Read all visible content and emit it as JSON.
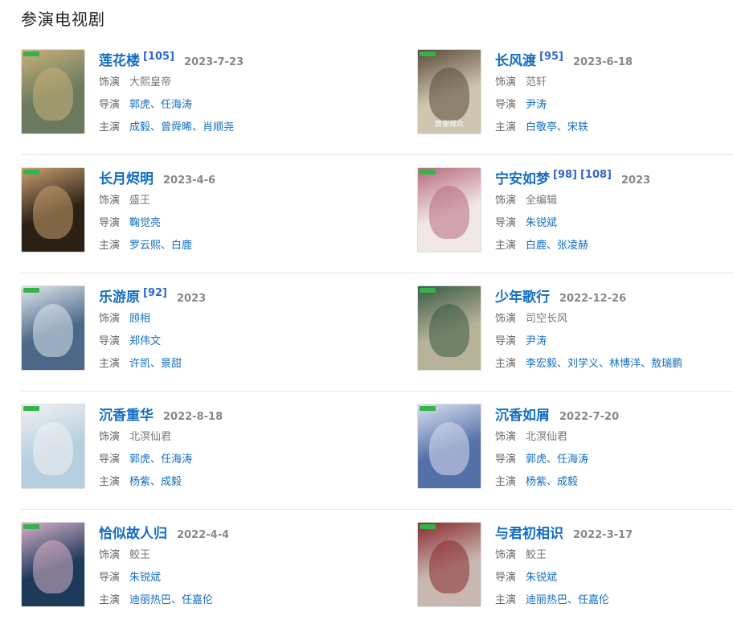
{
  "section_title": "参演电视剧",
  "labels": {
    "role": "饰演",
    "director": "导演",
    "starring": "主演"
  },
  "dramas": [
    {
      "title": "莲花楼",
      "refs": [
        "[105]"
      ],
      "date": "2023-7-23",
      "role": "大熙皇帝",
      "role_linked": false,
      "directors": [
        "郭虎",
        "任海涛"
      ],
      "starring": [
        "成毅",
        "曾舜晞",
        "肖顺尧"
      ],
      "poster_color": "#6b7a5e",
      "poster_accent": "#c8b07a"
    },
    {
      "title": "长风渡",
      "refs": [
        "[95]"
      ],
      "date": "2023-6-18",
      "role": "范轩",
      "role_linked": false,
      "directors": [
        "尹涛"
      ],
      "starring": [
        "白敬亭",
        "宋轶"
      ],
      "poster_color": "#cfc6b0",
      "poster_accent": "#5a4a3a",
      "poster_caption": "致谢观众"
    },
    {
      "title": "长月烬明",
      "refs": [],
      "date": "2023-4-6",
      "role": "盛王",
      "role_linked": false,
      "directors": [
        "鞠觉亮"
      ],
      "starring": [
        "罗云熙",
        "白鹿"
      ],
      "poster_color": "#2a2016",
      "poster_accent": "#c8a070"
    },
    {
      "title": "宁安如梦",
      "refs": [
        "[98]",
        "[108]"
      ],
      "date": "2023",
      "role": "全编辑",
      "role_linked": false,
      "directors": [
        "朱锐斌"
      ],
      "starring": [
        "白鹿",
        "张凌赫"
      ],
      "poster_color": "#efe8e6",
      "poster_accent": "#b86a80"
    },
    {
      "title": "乐游原",
      "refs": [
        "[92]"
      ],
      "date": "2023",
      "role": "顾相",
      "role_linked": true,
      "directors": [
        "郑伟文"
      ],
      "starring": [
        "许凯",
        "景甜"
      ],
      "poster_color": "#4b6888",
      "poster_accent": "#dfe6ee"
    },
    {
      "title": "少年歌行",
      "refs": [],
      "date": "2022-12-26",
      "role": "司空长风",
      "role_linked": false,
      "directors": [
        "尹涛"
      ],
      "starring": [
        "李宏毅",
        "刘学义",
        "林博洋",
        "敖瑞鹏"
      ],
      "poster_color": "#b7b29a",
      "poster_accent": "#3a5a42"
    },
    {
      "title": "沉香重华",
      "refs": [],
      "date": "2022-8-18",
      "role": "北溟仙君",
      "role_linked": false,
      "directors": [
        "郭虎",
        "任海涛"
      ],
      "starring": [
        "杨紫",
        "成毅"
      ],
      "poster_color": "#b6cfe0",
      "poster_accent": "#f2f2f2"
    },
    {
      "title": "沉香如屑",
      "refs": [],
      "date": "2022-7-20",
      "role": "北溟仙君",
      "role_linked": false,
      "directors": [
        "郭虎",
        "任海涛"
      ],
      "starring": [
        "杨紫",
        "成毅"
      ],
      "poster_color": "#5470a8",
      "poster_accent": "#d8dff0"
    },
    {
      "title": "恰似故人归",
      "refs": [],
      "date": "2022-4-4",
      "role": "鲛王",
      "role_linked": false,
      "directors": [
        "朱锐斌"
      ],
      "starring": [
        "迪丽热巴",
        "任嘉伦"
      ],
      "poster_color": "#1e3a5a",
      "poster_accent": "#d8b0c8"
    },
    {
      "title": "与君初相识",
      "refs": [],
      "date": "2022-3-17",
      "role": "鲛王",
      "role_linked": false,
      "directors": [
        "朱锐斌"
      ],
      "starring": [
        "迪丽热巴",
        "任嘉伦"
      ],
      "poster_color": "#c8b8b0",
      "poster_accent": "#8a2a30"
    }
  ]
}
